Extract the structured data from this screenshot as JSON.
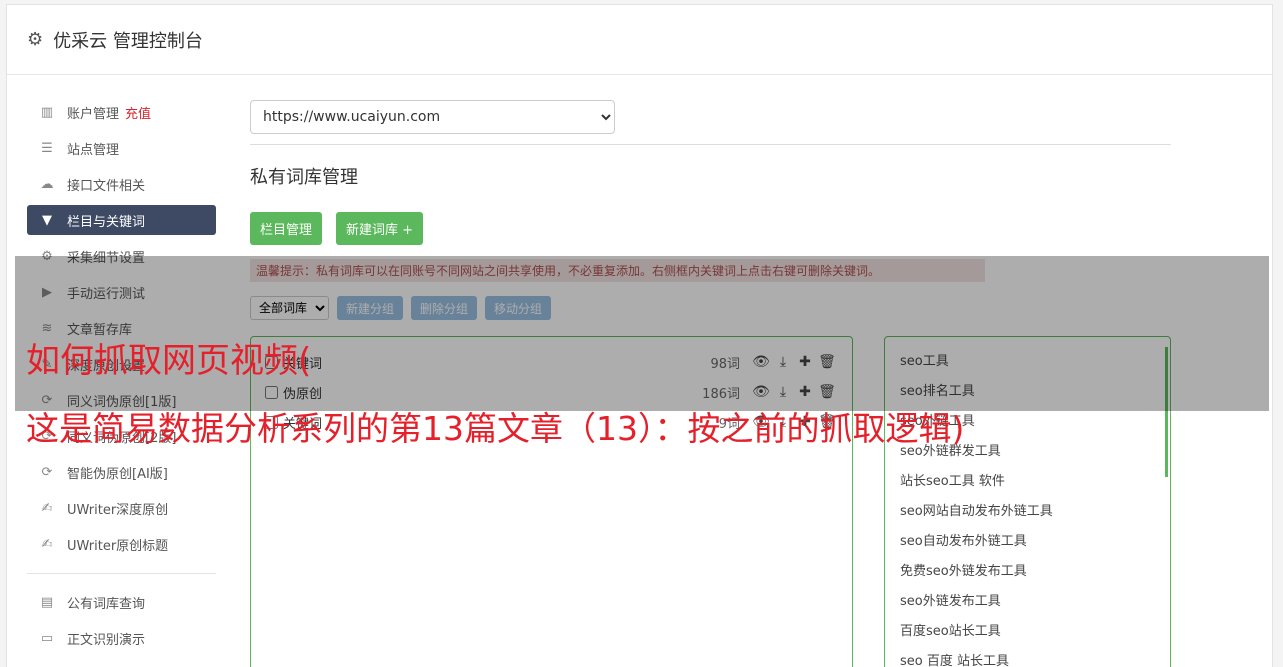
{
  "header": {
    "title": "优采云 管理控制台",
    "icon": "gear-icon"
  },
  "sidebar": {
    "items": [
      {
        "label": "账户管理",
        "icon": "bar-chart-icon",
        "badge": "充值"
      },
      {
        "label": "站点管理",
        "icon": "server-icon"
      },
      {
        "label": "接口文件相关",
        "icon": "cloud-upload-icon"
      },
      {
        "label": "栏目与关键词",
        "icon": "filter-icon",
        "active": true
      },
      {
        "label": "采集细节设置",
        "icon": "cogs-icon"
      },
      {
        "label": "手动运行测试",
        "icon": "play-circle-icon"
      },
      {
        "label": "文章暂存库",
        "icon": "database-icon"
      },
      {
        "label": "深度原创设置",
        "icon": "edit-icon"
      },
      {
        "label": "同义词伪原创[1版]",
        "icon": "refresh-icon"
      },
      {
        "label": "同义词伪原创[2版]",
        "icon": "refresh-icon"
      },
      {
        "label": "智能伪原创[AI版]",
        "icon": "refresh-icon"
      },
      {
        "label": "UWriter深度原创",
        "icon": "pencil-icon"
      },
      {
        "label": "UWriter原创标题",
        "icon": "pencil-icon"
      }
    ],
    "items2": [
      {
        "label": "公有词库查询",
        "icon": "book-icon"
      },
      {
        "label": "正文识别演示",
        "icon": "monitor-icon"
      }
    ]
  },
  "main": {
    "site_select": "https://www.ucaiyun.com",
    "page_title": "私有词库管理",
    "btn_category": "栏目管理",
    "btn_new_lexicon": "新建词库 +",
    "tip": "温馨提示：私有词库可以在同账号不同网站之间共享使用，不必重复添加。右侧框内关键词上点击右键可删除关键词。",
    "group_select": "全部词库",
    "btn_new_group": "新建分组",
    "btn_delete_group": "删除分组",
    "btn_move_group": "移动分组",
    "lexicons": [
      {
        "name": "关键词",
        "count": "98词"
      },
      {
        "name": "伪原创",
        "count": "186词"
      },
      {
        "name": "关键词",
        "count": "9词"
      }
    ],
    "keywords": [
      "seo工具",
      "seo排名工具",
      "seo外链工具",
      "seo外链群发工具",
      "站长seo工具 软件",
      "seo网站自动发布外链工具",
      "seo自动发布外链工具",
      "免费seo外链发布工具",
      "seo外链发布工具",
      "百度seo站长工具",
      "seo 百度 站长工具"
    ]
  },
  "overlay": {
    "line1": "如何抓取网页视频(",
    "line2": "这是简易数据分析系列的第13篇文章（13）：按之前的抓取逻辑)"
  }
}
